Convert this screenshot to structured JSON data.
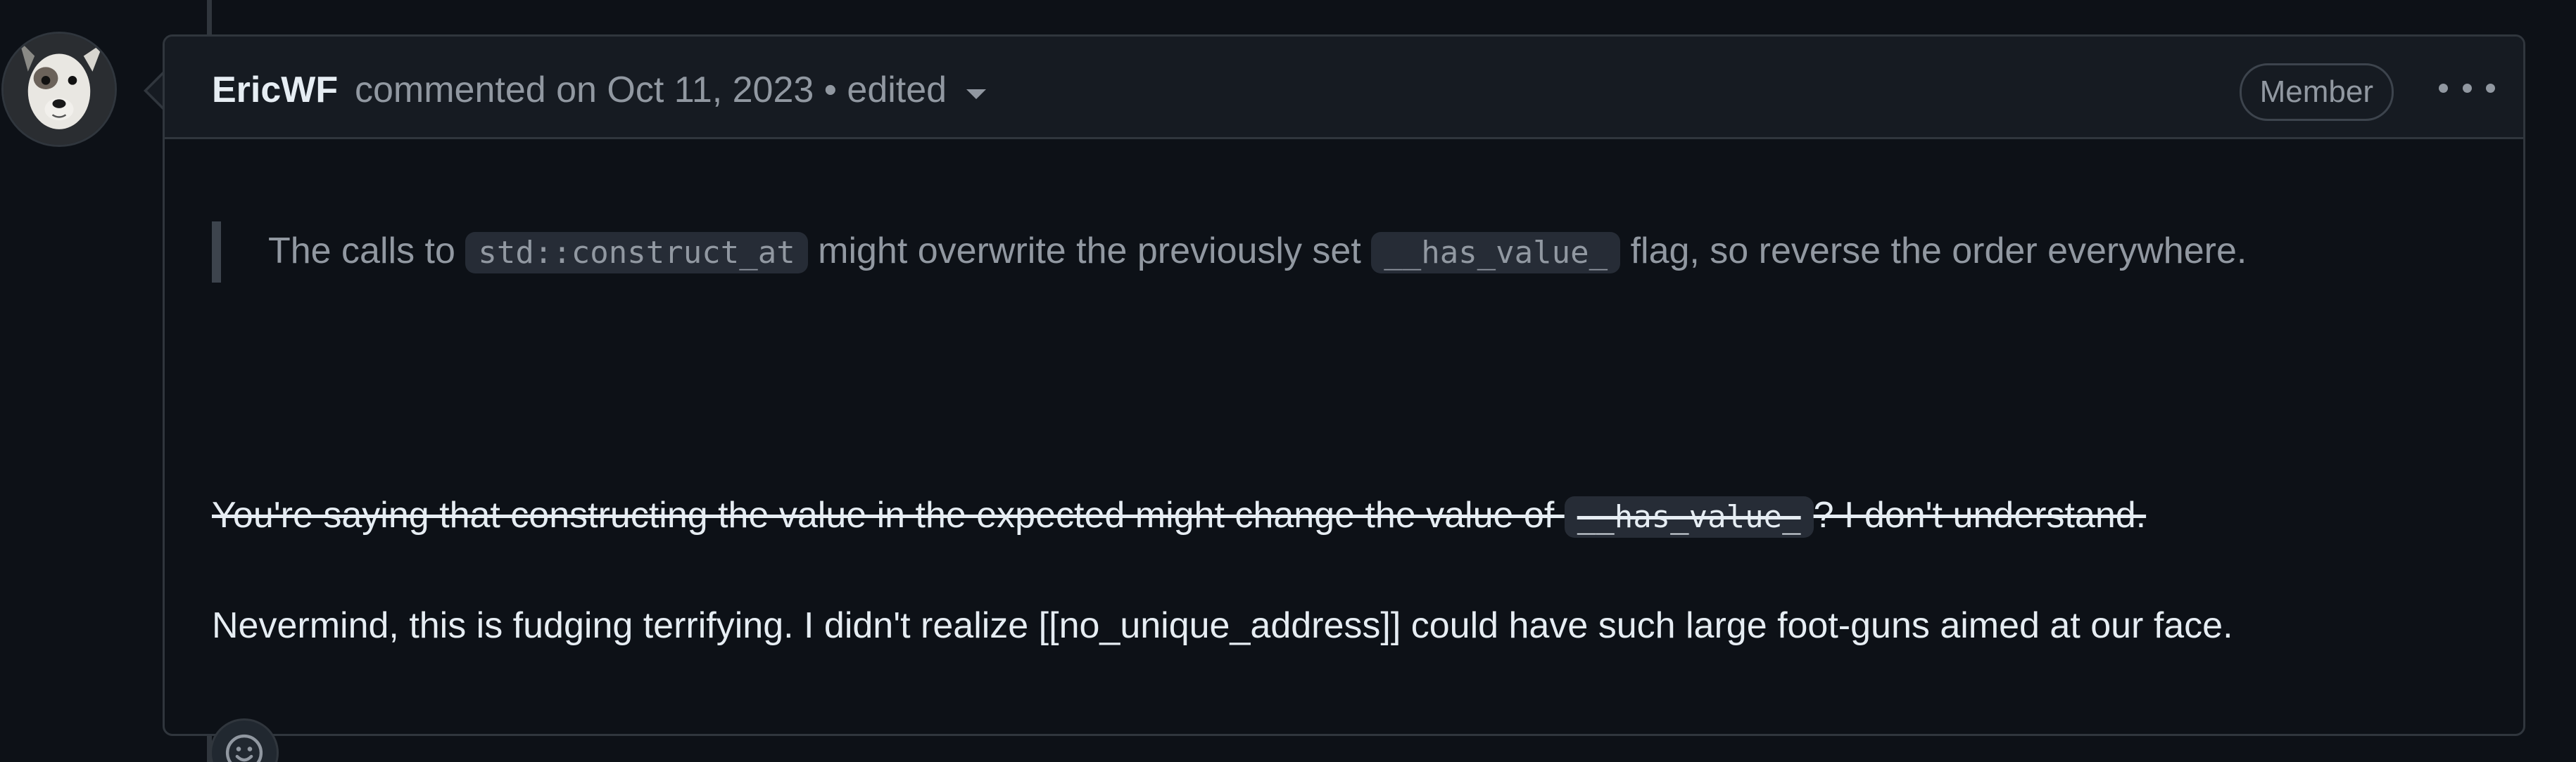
{
  "comment": {
    "author": "EricWF",
    "meta_text": "commented on Oct 11, 2023 • edited",
    "role_badge": "Member",
    "quote": {
      "before1": "The calls to ",
      "code1": "std::construct_at",
      "middle": " might overwrite the previously set ",
      "code2": "__has_value_",
      "after": " flag, so reverse the order everywhere."
    },
    "struck_paragraph": {
      "before": "You're saying that constructing the value in the expected might change the value of ",
      "code": "__has_value_",
      "after": "? I don't understand."
    },
    "paragraph": "Nevermind, this is fudging terrifying. I didn't realize [[no_unique_address]] could have such large foot-guns aimed at our face."
  },
  "icons": {
    "avatar": "avatar-dog",
    "menu": "kebab-horizontal-icon",
    "reaction": "smiley-icon",
    "edited_dropdown": "triangle-down-icon"
  },
  "colors": {
    "background": "#0d1117",
    "header_background": "#161b22",
    "border": "#30363d",
    "text": "#e6edf3",
    "muted_text": "#9198a1"
  }
}
